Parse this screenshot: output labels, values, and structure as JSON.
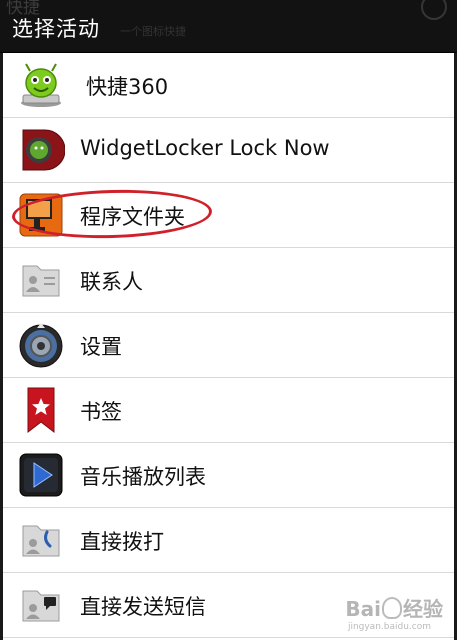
{
  "dialog": {
    "title": "选择活动",
    "background_title": "快捷",
    "background_subtitle": "一个图标快捷"
  },
  "items": [
    {
      "label": "快捷360",
      "icon": "android-robot-icon"
    },
    {
      "label": "WidgetLocker Lock Now",
      "icon": "widgetlocker-icon"
    },
    {
      "label": "程序文件夹",
      "icon": "app-folder-icon",
      "highlighted": true
    },
    {
      "label": "联系人",
      "icon": "contact-icon"
    },
    {
      "label": "设置",
      "icon": "settings-dial-icon"
    },
    {
      "label": "书签",
      "icon": "bookmark-icon"
    },
    {
      "label": "音乐播放列表",
      "icon": "music-playlist-icon"
    },
    {
      "label": "直接拨打",
      "icon": "direct-dial-icon"
    },
    {
      "label": "直接发送短信",
      "icon": "direct-message-icon"
    }
  ],
  "watermark": {
    "text": "Bai",
    "text2": "经验",
    "sub": "jingyan.baidu.com"
  },
  "colors": {
    "title_bar": "#121212",
    "highlight": "#d0212a",
    "list_bg": "#ffffff"
  }
}
